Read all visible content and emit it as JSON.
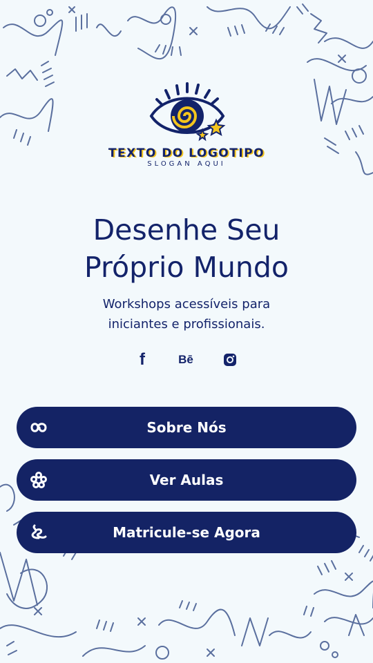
{
  "logo": {
    "text": "TEXTO DO LOGOTIPO",
    "slogan": "SLOGAN AQUI",
    "icon": "eye-with-spiral-and-stars",
    "accent": "#f4c51d"
  },
  "hero": {
    "headline_line1": "Desenhe Seu",
    "headline_line2": "Próprio Mundo",
    "subtitle_line1": "Workshops acessíveis para",
    "subtitle_line2": "iniciantes e profissionais."
  },
  "social": {
    "facebook_label": "f",
    "behance_label": "Bē",
    "instagram": "instagram-icon"
  },
  "buttons": [
    {
      "label": "Sobre Nós",
      "icon": "loop-icon"
    },
    {
      "label": "Ver Aulas",
      "icon": "flower-icon"
    },
    {
      "label": "Matricule-se Agora",
      "icon": "squiggle-icon"
    }
  ],
  "colors": {
    "background": "#f3f9fc",
    "navy": "#142365",
    "doodle": "#5a6f9e",
    "yellow": "#f4c51d"
  }
}
